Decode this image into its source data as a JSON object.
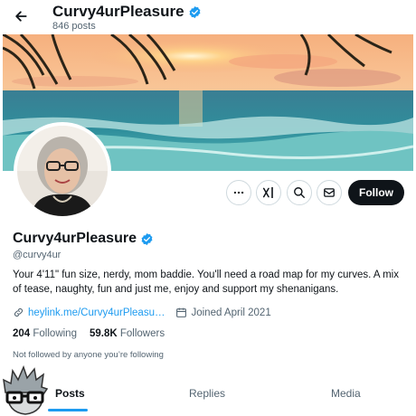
{
  "header": {
    "display_name": "Curvy4urPleasure",
    "post_count": "846 posts"
  },
  "profile": {
    "display_name": "Curvy4urPleasure",
    "handle": "@curvy4ur",
    "bio": "Your 4'11\" fun size, nerdy, mom baddie. You'll need a road map for my curves. A mix of tease, naughty, fun and just me, enjoy and support my shenanigans.",
    "link": "heylink.me/Curvy4urPleasu…",
    "joined": "Joined April 2021",
    "following_count": "204",
    "following_label": "Following",
    "followers_count": "59.8K",
    "followers_label": "Followers",
    "not_followed": "Not followed by anyone you’re following"
  },
  "actions": {
    "follow_label": "Follow",
    "icons": [
      "more-icon",
      "grok-icon",
      "search-icon",
      "message-icon"
    ]
  },
  "tabs": [
    {
      "label": "Posts",
      "selected": true
    },
    {
      "label": "Replies",
      "selected": false
    },
    {
      "label": "Media",
      "selected": false
    }
  ],
  "colors": {
    "accent": "#1d9bf0",
    "text_primary": "#0f1419",
    "text_secondary": "#536471",
    "follow_button": "#0f1419"
  }
}
